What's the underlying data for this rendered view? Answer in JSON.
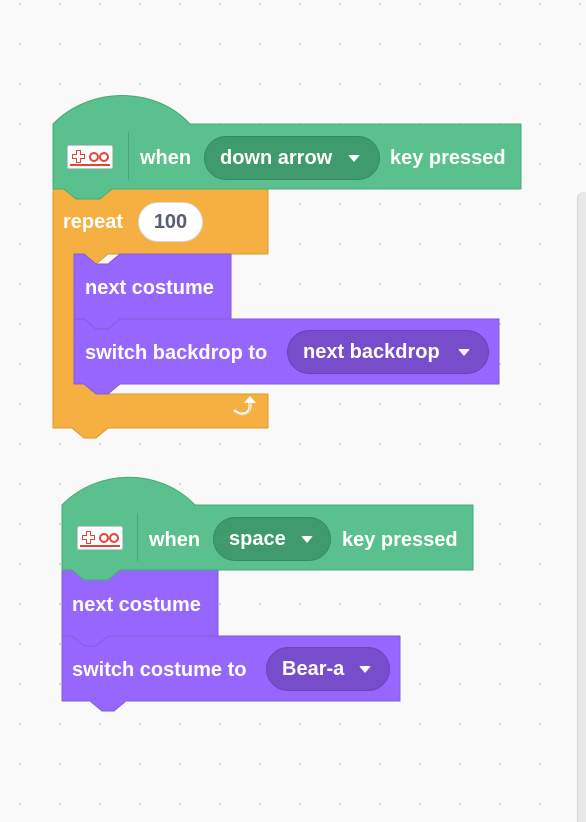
{
  "colors": {
    "events": "#59c08e",
    "events_dark": "#3f9b6e",
    "control": "#f5b041",
    "looks": "#9766ff",
    "looks_dark": "#774dcb",
    "workspace_bg": "#f9f9f9"
  },
  "scripts": [
    {
      "hat": {
        "icon": "makey-makey-extension-icon",
        "when_label": "when",
        "key_value": "down arrow",
        "suffix_label": "key pressed"
      },
      "repeat": {
        "label": "repeat",
        "count": "100",
        "icon": "loop-arrow-icon"
      },
      "inner": [
        {
          "label": "next costume"
        },
        {
          "label": "switch backdrop to",
          "dropdown": "next backdrop"
        }
      ]
    },
    {
      "hat": {
        "icon": "makey-makey-extension-icon",
        "when_label": "when",
        "key_value": "space",
        "suffix_label": "key pressed"
      },
      "blocks": [
        {
          "label": "next costume"
        },
        {
          "label": "switch costume to",
          "dropdown": "Bear-a"
        }
      ]
    }
  ]
}
